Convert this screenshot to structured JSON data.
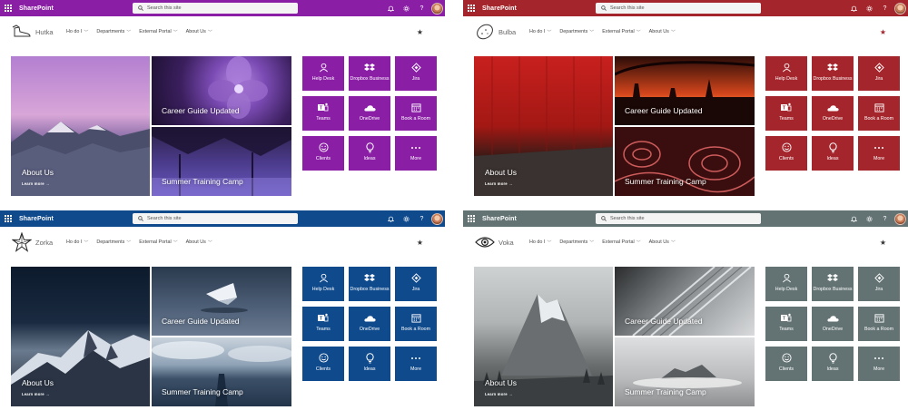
{
  "suite": {
    "brand": "SharePoint",
    "search_placeholder": "Search this site"
  },
  "nav": {
    "items": [
      {
        "label": "Ho do I"
      },
      {
        "label": "Departments"
      },
      {
        "label": "External Portal"
      },
      {
        "label": "About Us"
      }
    ]
  },
  "hero": {
    "big_title": "About Us",
    "learn_more": "Learn more →",
    "top_right_title": "Career Guide Updated",
    "bottom_right_title": "Summer Training Camp"
  },
  "quicklinks": [
    {
      "label": "Help Desk",
      "icon": "person-icon"
    },
    {
      "label": "Dropbox Business",
      "icon": "dropbox-icon"
    },
    {
      "label": "Jira",
      "icon": "jira-icon"
    },
    {
      "label": "Teams",
      "icon": "teams-icon"
    },
    {
      "label": "OneDrive",
      "icon": "onedrive-icon"
    },
    {
      "label": "Book a Room",
      "icon": "calendar-icon"
    },
    {
      "label": "Clients",
      "icon": "smiley-icon"
    },
    {
      "label": "Ideas",
      "icon": "lightbulb-icon"
    },
    {
      "label": "More",
      "icon": "ellipsis-icon"
    }
  ],
  "sites": [
    {
      "title": "Hutka",
      "theme_color": "#8a1fa6",
      "logo_icon": "boot-icon"
    },
    {
      "title": "Bulba",
      "theme_color": "#a4262c",
      "logo_icon": "potato-icon"
    },
    {
      "title": "Zorka",
      "theme_color": "#0f4a8c",
      "logo_icon": "star-icon"
    },
    {
      "title": "Voka",
      "theme_color": "#637273",
      "logo_icon": "eye-icon"
    }
  ]
}
